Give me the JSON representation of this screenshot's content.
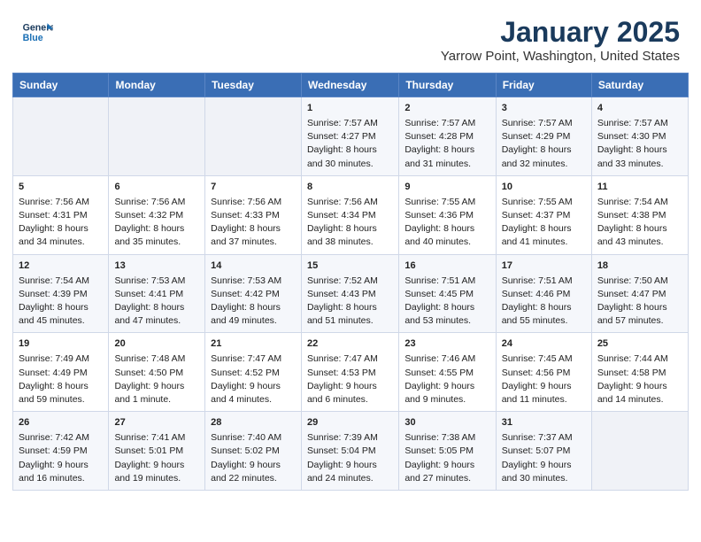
{
  "header": {
    "logo_line1": "General",
    "logo_line2": "Blue",
    "month": "January 2025",
    "location": "Yarrow Point, Washington, United States"
  },
  "days_of_week": [
    "Sunday",
    "Monday",
    "Tuesday",
    "Wednesday",
    "Thursday",
    "Friday",
    "Saturday"
  ],
  "weeks": [
    [
      {
        "day": "",
        "info": ""
      },
      {
        "day": "",
        "info": ""
      },
      {
        "day": "",
        "info": ""
      },
      {
        "day": "1",
        "info": "Sunrise: 7:57 AM\nSunset: 4:27 PM\nDaylight: 8 hours and 30 minutes."
      },
      {
        "day": "2",
        "info": "Sunrise: 7:57 AM\nSunset: 4:28 PM\nDaylight: 8 hours and 31 minutes."
      },
      {
        "day": "3",
        "info": "Sunrise: 7:57 AM\nSunset: 4:29 PM\nDaylight: 8 hours and 32 minutes."
      },
      {
        "day": "4",
        "info": "Sunrise: 7:57 AM\nSunset: 4:30 PM\nDaylight: 8 hours and 33 minutes."
      }
    ],
    [
      {
        "day": "5",
        "info": "Sunrise: 7:56 AM\nSunset: 4:31 PM\nDaylight: 8 hours and 34 minutes."
      },
      {
        "day": "6",
        "info": "Sunrise: 7:56 AM\nSunset: 4:32 PM\nDaylight: 8 hours and 35 minutes."
      },
      {
        "day": "7",
        "info": "Sunrise: 7:56 AM\nSunset: 4:33 PM\nDaylight: 8 hours and 37 minutes."
      },
      {
        "day": "8",
        "info": "Sunrise: 7:56 AM\nSunset: 4:34 PM\nDaylight: 8 hours and 38 minutes."
      },
      {
        "day": "9",
        "info": "Sunrise: 7:55 AM\nSunset: 4:36 PM\nDaylight: 8 hours and 40 minutes."
      },
      {
        "day": "10",
        "info": "Sunrise: 7:55 AM\nSunset: 4:37 PM\nDaylight: 8 hours and 41 minutes."
      },
      {
        "day": "11",
        "info": "Sunrise: 7:54 AM\nSunset: 4:38 PM\nDaylight: 8 hours and 43 minutes."
      }
    ],
    [
      {
        "day": "12",
        "info": "Sunrise: 7:54 AM\nSunset: 4:39 PM\nDaylight: 8 hours and 45 minutes."
      },
      {
        "day": "13",
        "info": "Sunrise: 7:53 AM\nSunset: 4:41 PM\nDaylight: 8 hours and 47 minutes."
      },
      {
        "day": "14",
        "info": "Sunrise: 7:53 AM\nSunset: 4:42 PM\nDaylight: 8 hours and 49 minutes."
      },
      {
        "day": "15",
        "info": "Sunrise: 7:52 AM\nSunset: 4:43 PM\nDaylight: 8 hours and 51 minutes."
      },
      {
        "day": "16",
        "info": "Sunrise: 7:51 AM\nSunset: 4:45 PM\nDaylight: 8 hours and 53 minutes."
      },
      {
        "day": "17",
        "info": "Sunrise: 7:51 AM\nSunset: 4:46 PM\nDaylight: 8 hours and 55 minutes."
      },
      {
        "day": "18",
        "info": "Sunrise: 7:50 AM\nSunset: 4:47 PM\nDaylight: 8 hours and 57 minutes."
      }
    ],
    [
      {
        "day": "19",
        "info": "Sunrise: 7:49 AM\nSunset: 4:49 PM\nDaylight: 8 hours and 59 minutes."
      },
      {
        "day": "20",
        "info": "Sunrise: 7:48 AM\nSunset: 4:50 PM\nDaylight: 9 hours and 1 minute."
      },
      {
        "day": "21",
        "info": "Sunrise: 7:47 AM\nSunset: 4:52 PM\nDaylight: 9 hours and 4 minutes."
      },
      {
        "day": "22",
        "info": "Sunrise: 7:47 AM\nSunset: 4:53 PM\nDaylight: 9 hours and 6 minutes."
      },
      {
        "day": "23",
        "info": "Sunrise: 7:46 AM\nSunset: 4:55 PM\nDaylight: 9 hours and 9 minutes."
      },
      {
        "day": "24",
        "info": "Sunrise: 7:45 AM\nSunset: 4:56 PM\nDaylight: 9 hours and 11 minutes."
      },
      {
        "day": "25",
        "info": "Sunrise: 7:44 AM\nSunset: 4:58 PM\nDaylight: 9 hours and 14 minutes."
      }
    ],
    [
      {
        "day": "26",
        "info": "Sunrise: 7:42 AM\nSunset: 4:59 PM\nDaylight: 9 hours and 16 minutes."
      },
      {
        "day": "27",
        "info": "Sunrise: 7:41 AM\nSunset: 5:01 PM\nDaylight: 9 hours and 19 minutes."
      },
      {
        "day": "28",
        "info": "Sunrise: 7:40 AM\nSunset: 5:02 PM\nDaylight: 9 hours and 22 minutes."
      },
      {
        "day": "29",
        "info": "Sunrise: 7:39 AM\nSunset: 5:04 PM\nDaylight: 9 hours and 24 minutes."
      },
      {
        "day": "30",
        "info": "Sunrise: 7:38 AM\nSunset: 5:05 PM\nDaylight: 9 hours and 27 minutes."
      },
      {
        "day": "31",
        "info": "Sunrise: 7:37 AM\nSunset: 5:07 PM\nDaylight: 9 hours and 30 minutes."
      },
      {
        "day": "",
        "info": ""
      }
    ]
  ]
}
